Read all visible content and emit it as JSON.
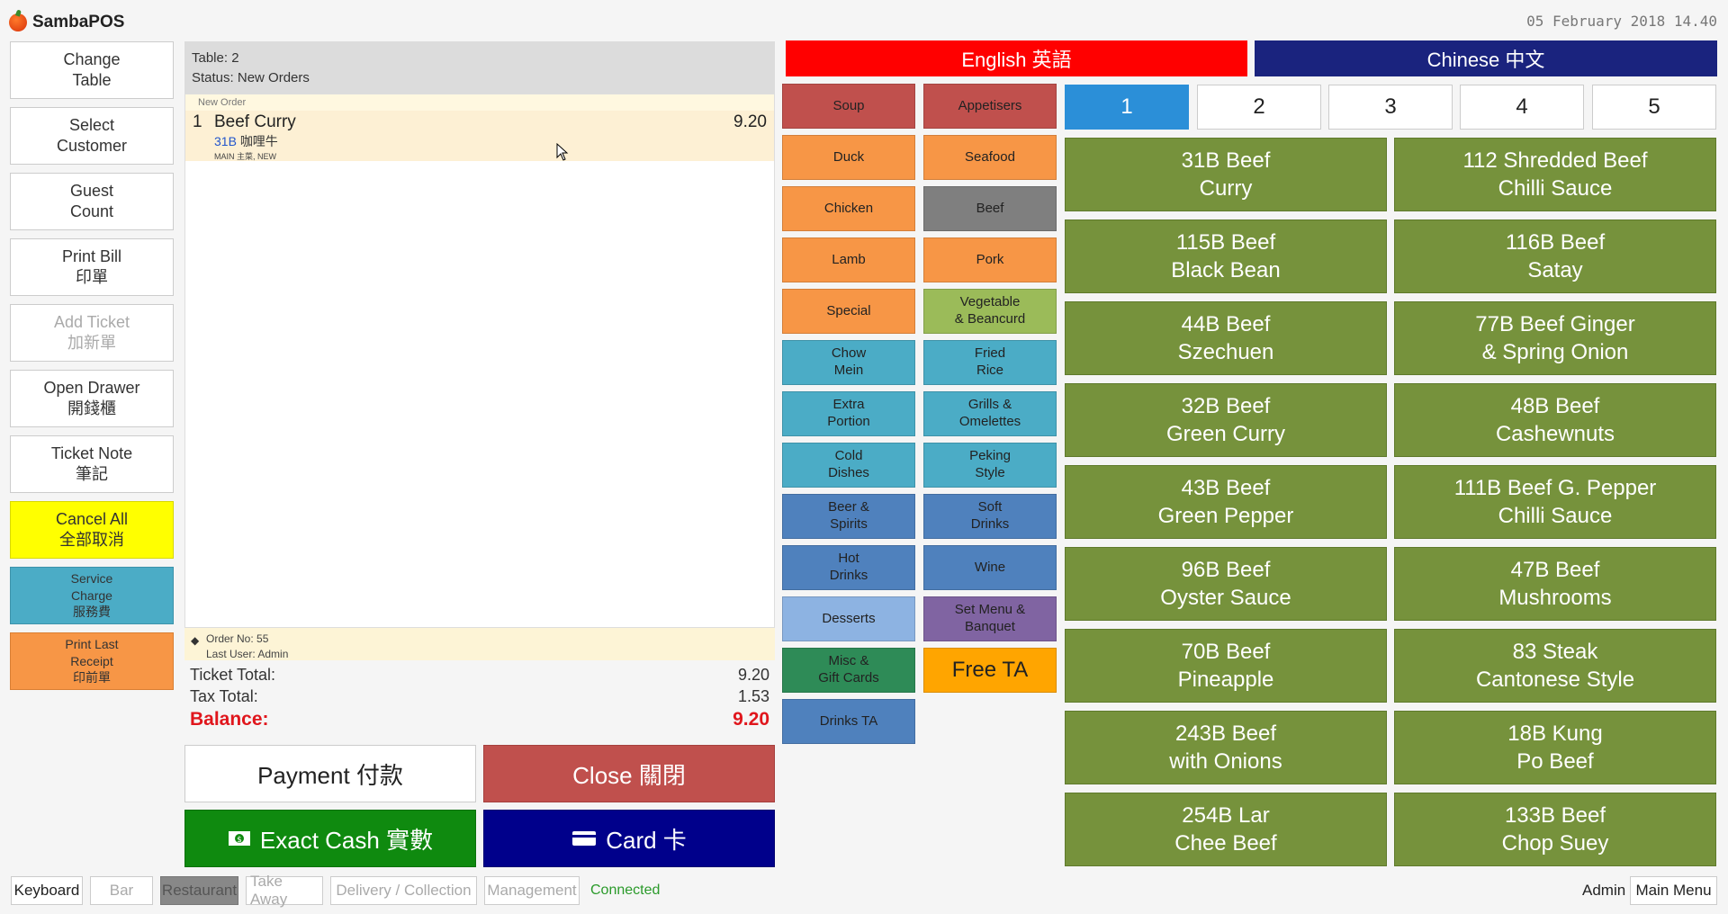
{
  "app": {
    "title": "SambaPOS",
    "datetime": "05 February 2018 14.40"
  },
  "commands": [
    {
      "line1": "Change",
      "line2": "Table"
    },
    {
      "line1": "Select",
      "line2": "Customer"
    },
    {
      "line1": "Guest",
      "line2": "Count"
    },
    {
      "line1": "Print Bill",
      "line2": "印單"
    },
    {
      "line1": "Add Ticket",
      "line2": "加新單"
    },
    {
      "line1": "Open Drawer",
      "line2": "開錢櫃"
    },
    {
      "line1": "Ticket Note",
      "line2": "筆記"
    },
    {
      "line1": "Cancel All",
      "line2": "全部取消"
    },
    {
      "line1": "Service",
      "line2": "Charge",
      "line3": "服務費"
    },
    {
      "line1": "Print Last",
      "line2": "Receipt",
      "line3": "印前單"
    }
  ],
  "ticket": {
    "table": "Table: 2",
    "status": "Status: New Orders",
    "group_label": "New Order",
    "order": {
      "qty": "1",
      "name": "Beef Curry",
      "price": "9.20",
      "code": "31B",
      "cn_name": "咖哩牛",
      "tags": "MAIN 主菜, NEW"
    },
    "order_no": "Order No: 55",
    "last_user": "Last User: Admin",
    "ticket_total_label": "Ticket Total:",
    "ticket_total": "9.20",
    "tax_total_label": "Tax Total:",
    "tax_total": "1.53",
    "balance_label": "Balance:",
    "balance": "9.20"
  },
  "actions": {
    "payment": "Payment 付款",
    "close": "Close 關閉",
    "exact_cash": "Exact Cash 實數",
    "card": "Card 卡"
  },
  "departments": {
    "english": "English 英語",
    "chinese": "Chinese 中文"
  },
  "categories": [
    {
      "label": "Soup",
      "color": "#c0504d"
    },
    {
      "label": "Appetisers",
      "color": "#c0504d"
    },
    {
      "label": "Duck",
      "color": "#f79646"
    },
    {
      "label": "Seafood",
      "color": "#f79646"
    },
    {
      "label": "Chicken",
      "color": "#f79646"
    },
    {
      "label": "Beef",
      "color": "#7f7f7f"
    },
    {
      "label": "Lamb",
      "color": "#f79646"
    },
    {
      "label": "Pork",
      "color": "#f79646"
    },
    {
      "label": "Special",
      "color": "#f79646"
    },
    {
      "label": "Vegetable\n& Beancurd",
      "color": "#9bbb59"
    },
    {
      "label": "Chow\nMein",
      "color": "#4bacc6"
    },
    {
      "label": "Fried\nRice",
      "color": "#4bacc6"
    },
    {
      "label": "Extra\nPortion",
      "color": "#4bacc6"
    },
    {
      "label": "Grills &\nOmelettes",
      "color": "#4bacc6"
    },
    {
      "label": "Cold\nDishes",
      "color": "#4bacc6"
    },
    {
      "label": "Peking\nStyle",
      "color": "#4bacc6"
    },
    {
      "label": "Beer &\nSpirits",
      "color": "#4f81bd"
    },
    {
      "label": "Soft\nDrinks",
      "color": "#4f81bd"
    },
    {
      "label": "Hot\nDrinks",
      "color": "#4f81bd"
    },
    {
      "label": "Wine",
      "color": "#4f81bd"
    },
    {
      "label": "Desserts",
      "color": "#8db3e2"
    },
    {
      "label": "Set Menu &\nBanquet",
      "color": "#8064a2"
    },
    {
      "label": "Misc &\nGift Cards",
      "color": "#2e8b57"
    },
    {
      "label": "Free TA",
      "color": "#ffa500"
    },
    {
      "label": "Drinks TA",
      "color": "#4f81bd"
    }
  ],
  "pages": [
    "1",
    "2",
    "3",
    "4",
    "5"
  ],
  "menu_items": [
    "31B Beef\nCurry",
    "112 Shredded Beef\nChilli Sauce",
    "115B Beef\nBlack Bean",
    "116B Beef\nSatay",
    "44B Beef\nSzechuen",
    "77B Beef Ginger\n& Spring Onion",
    "32B Beef\nGreen Curry",
    "48B Beef\nCashewnuts",
    "43B Beef\nGreen Pepper",
    "111B Beef G. Pepper\nChilli Sauce",
    "96B Beef\nOyster Sauce",
    "47B Beef\nMushrooms",
    "70B Beef\nPineapple",
    "83 Steak\nCantonese Style",
    "243B Beef\nwith Onions",
    "18B Kung\nPo Beef",
    "254B Lar\nChee Beef",
    "133B Beef\nChop Suey"
  ],
  "bottom_bar": {
    "keyboard": "Keyboard",
    "bar": "Bar",
    "restaurant": "Restaurant",
    "take_away": "Take Away",
    "delivery": "Delivery / Collection",
    "management": "Management",
    "status": "Connected",
    "user": "Admin",
    "main_menu": "Main Menu"
  }
}
